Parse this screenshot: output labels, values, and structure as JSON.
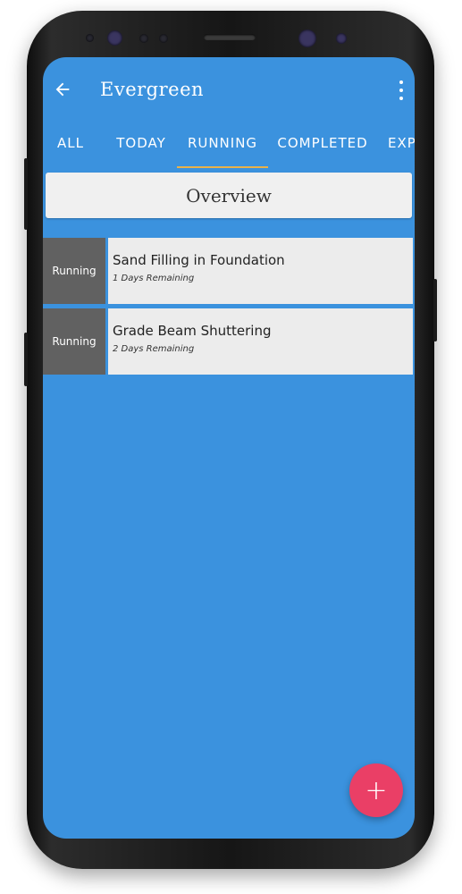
{
  "app": {
    "title": "Evergreen"
  },
  "tabs": [
    {
      "label": "ALL"
    },
    {
      "label": "TODAY"
    },
    {
      "label": "RUNNING"
    },
    {
      "label": "COMPLETED"
    },
    {
      "label": "EXPI"
    }
  ],
  "active_tab": "RUNNING",
  "overview": {
    "label": "Overview"
  },
  "tasks": [
    {
      "status": "Running",
      "title": "Sand Filling in Foundation",
      "remaining": "1 Days Remaining"
    },
    {
      "status": "Running",
      "title": "Grade Beam Shuttering",
      "remaining": "2 Days Remaining"
    }
  ],
  "fab": {
    "icon": "plus-icon",
    "symbol": "+"
  },
  "colors": {
    "screen_bg": "#3b92de",
    "tab_indicator": "#e9b24a",
    "status_bg": "#616161",
    "card_bg": "#ececec",
    "fab_bg": "#ea3f66"
  },
  "icons": {
    "back": "arrow-left-icon",
    "menu": "more-vertical-icon"
  }
}
